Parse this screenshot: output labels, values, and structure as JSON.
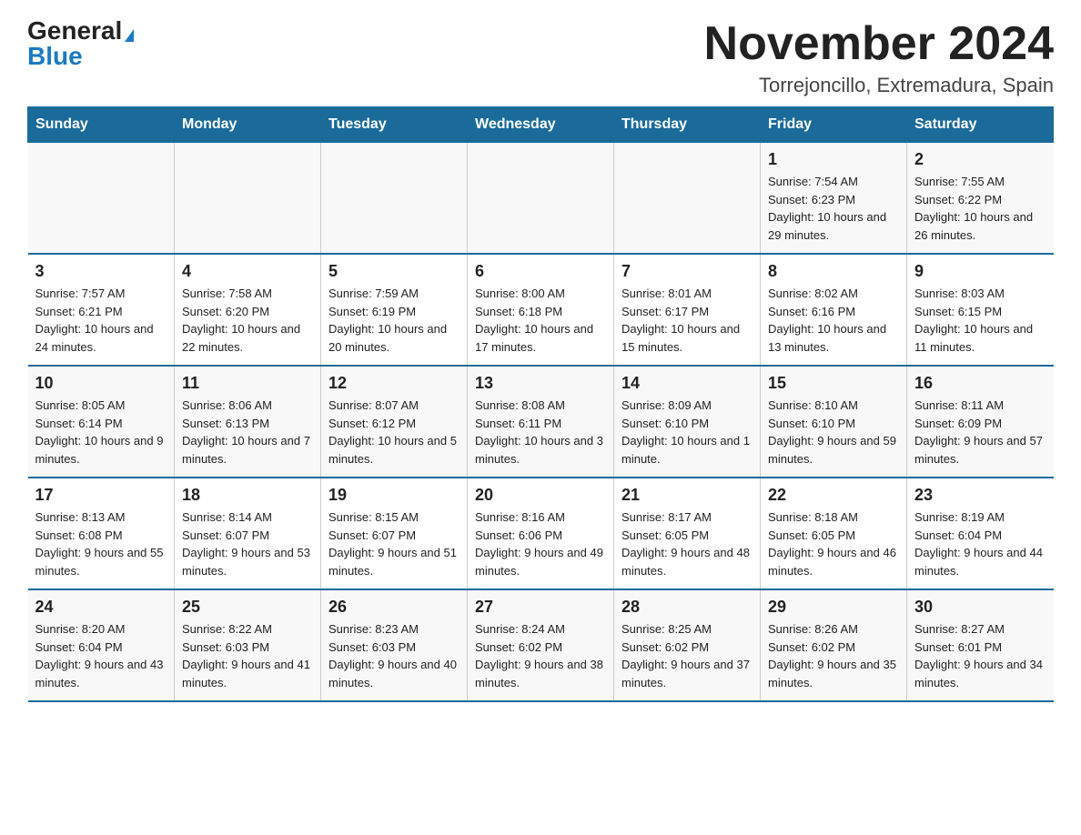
{
  "header": {
    "logo_general": "General",
    "logo_blue": "Blue",
    "month_title": "November 2024",
    "location": "Torrejoncillo, Extremadura, Spain"
  },
  "days_of_week": [
    "Sunday",
    "Monday",
    "Tuesday",
    "Wednesday",
    "Thursday",
    "Friday",
    "Saturday"
  ],
  "weeks": [
    [
      {
        "day": "",
        "sunrise": "",
        "sunset": "",
        "daylight": ""
      },
      {
        "day": "",
        "sunrise": "",
        "sunset": "",
        "daylight": ""
      },
      {
        "day": "",
        "sunrise": "",
        "sunset": "",
        "daylight": ""
      },
      {
        "day": "",
        "sunrise": "",
        "sunset": "",
        "daylight": ""
      },
      {
        "day": "",
        "sunrise": "",
        "sunset": "",
        "daylight": ""
      },
      {
        "day": "1",
        "sunrise": "Sunrise: 7:54 AM",
        "sunset": "Sunset: 6:23 PM",
        "daylight": "Daylight: 10 hours and 29 minutes."
      },
      {
        "day": "2",
        "sunrise": "Sunrise: 7:55 AM",
        "sunset": "Sunset: 6:22 PM",
        "daylight": "Daylight: 10 hours and 26 minutes."
      }
    ],
    [
      {
        "day": "3",
        "sunrise": "Sunrise: 7:57 AM",
        "sunset": "Sunset: 6:21 PM",
        "daylight": "Daylight: 10 hours and 24 minutes."
      },
      {
        "day": "4",
        "sunrise": "Sunrise: 7:58 AM",
        "sunset": "Sunset: 6:20 PM",
        "daylight": "Daylight: 10 hours and 22 minutes."
      },
      {
        "day": "5",
        "sunrise": "Sunrise: 7:59 AM",
        "sunset": "Sunset: 6:19 PM",
        "daylight": "Daylight: 10 hours and 20 minutes."
      },
      {
        "day": "6",
        "sunrise": "Sunrise: 8:00 AM",
        "sunset": "Sunset: 6:18 PM",
        "daylight": "Daylight: 10 hours and 17 minutes."
      },
      {
        "day": "7",
        "sunrise": "Sunrise: 8:01 AM",
        "sunset": "Sunset: 6:17 PM",
        "daylight": "Daylight: 10 hours and 15 minutes."
      },
      {
        "day": "8",
        "sunrise": "Sunrise: 8:02 AM",
        "sunset": "Sunset: 6:16 PM",
        "daylight": "Daylight: 10 hours and 13 minutes."
      },
      {
        "day": "9",
        "sunrise": "Sunrise: 8:03 AM",
        "sunset": "Sunset: 6:15 PM",
        "daylight": "Daylight: 10 hours and 11 minutes."
      }
    ],
    [
      {
        "day": "10",
        "sunrise": "Sunrise: 8:05 AM",
        "sunset": "Sunset: 6:14 PM",
        "daylight": "Daylight: 10 hours and 9 minutes."
      },
      {
        "day": "11",
        "sunrise": "Sunrise: 8:06 AM",
        "sunset": "Sunset: 6:13 PM",
        "daylight": "Daylight: 10 hours and 7 minutes."
      },
      {
        "day": "12",
        "sunrise": "Sunrise: 8:07 AM",
        "sunset": "Sunset: 6:12 PM",
        "daylight": "Daylight: 10 hours and 5 minutes."
      },
      {
        "day": "13",
        "sunrise": "Sunrise: 8:08 AM",
        "sunset": "Sunset: 6:11 PM",
        "daylight": "Daylight: 10 hours and 3 minutes."
      },
      {
        "day": "14",
        "sunrise": "Sunrise: 8:09 AM",
        "sunset": "Sunset: 6:10 PM",
        "daylight": "Daylight: 10 hours and 1 minute."
      },
      {
        "day": "15",
        "sunrise": "Sunrise: 8:10 AM",
        "sunset": "Sunset: 6:10 PM",
        "daylight": "Daylight: 9 hours and 59 minutes."
      },
      {
        "day": "16",
        "sunrise": "Sunrise: 8:11 AM",
        "sunset": "Sunset: 6:09 PM",
        "daylight": "Daylight: 9 hours and 57 minutes."
      }
    ],
    [
      {
        "day": "17",
        "sunrise": "Sunrise: 8:13 AM",
        "sunset": "Sunset: 6:08 PM",
        "daylight": "Daylight: 9 hours and 55 minutes."
      },
      {
        "day": "18",
        "sunrise": "Sunrise: 8:14 AM",
        "sunset": "Sunset: 6:07 PM",
        "daylight": "Daylight: 9 hours and 53 minutes."
      },
      {
        "day": "19",
        "sunrise": "Sunrise: 8:15 AM",
        "sunset": "Sunset: 6:07 PM",
        "daylight": "Daylight: 9 hours and 51 minutes."
      },
      {
        "day": "20",
        "sunrise": "Sunrise: 8:16 AM",
        "sunset": "Sunset: 6:06 PM",
        "daylight": "Daylight: 9 hours and 49 minutes."
      },
      {
        "day": "21",
        "sunrise": "Sunrise: 8:17 AM",
        "sunset": "Sunset: 6:05 PM",
        "daylight": "Daylight: 9 hours and 48 minutes."
      },
      {
        "day": "22",
        "sunrise": "Sunrise: 8:18 AM",
        "sunset": "Sunset: 6:05 PM",
        "daylight": "Daylight: 9 hours and 46 minutes."
      },
      {
        "day": "23",
        "sunrise": "Sunrise: 8:19 AM",
        "sunset": "Sunset: 6:04 PM",
        "daylight": "Daylight: 9 hours and 44 minutes."
      }
    ],
    [
      {
        "day": "24",
        "sunrise": "Sunrise: 8:20 AM",
        "sunset": "Sunset: 6:04 PM",
        "daylight": "Daylight: 9 hours and 43 minutes."
      },
      {
        "day": "25",
        "sunrise": "Sunrise: 8:22 AM",
        "sunset": "Sunset: 6:03 PM",
        "daylight": "Daylight: 9 hours and 41 minutes."
      },
      {
        "day": "26",
        "sunrise": "Sunrise: 8:23 AM",
        "sunset": "Sunset: 6:03 PM",
        "daylight": "Daylight: 9 hours and 40 minutes."
      },
      {
        "day": "27",
        "sunrise": "Sunrise: 8:24 AM",
        "sunset": "Sunset: 6:02 PM",
        "daylight": "Daylight: 9 hours and 38 minutes."
      },
      {
        "day": "28",
        "sunrise": "Sunrise: 8:25 AM",
        "sunset": "Sunset: 6:02 PM",
        "daylight": "Daylight: 9 hours and 37 minutes."
      },
      {
        "day": "29",
        "sunrise": "Sunrise: 8:26 AM",
        "sunset": "Sunset: 6:02 PM",
        "daylight": "Daylight: 9 hours and 35 minutes."
      },
      {
        "day": "30",
        "sunrise": "Sunrise: 8:27 AM",
        "sunset": "Sunset: 6:01 PM",
        "daylight": "Daylight: 9 hours and 34 minutes."
      }
    ]
  ]
}
